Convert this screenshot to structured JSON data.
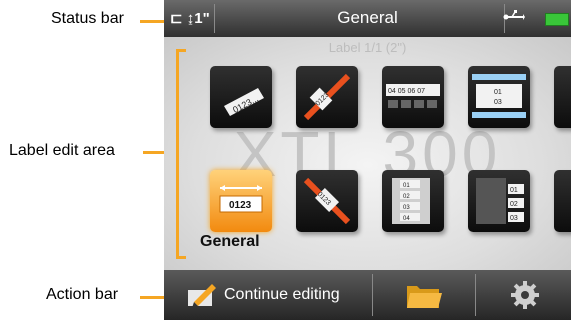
{
  "callouts": {
    "status_bar": "Status bar",
    "label_edit_area": "Label edit area",
    "action_bar": "Action bar"
  },
  "status_bar": {
    "left_indicator": "⊏ ↨1\"",
    "title": "General",
    "usb_icon": "usb-icon",
    "battery_icon": "battery-icon"
  },
  "edit_area": {
    "subtitle": "Label 1/1 (2\")",
    "watermark": "XTL 300",
    "selected_label": "General",
    "tiles": [
      {
        "name": "general-tile",
        "text": "0123..."
      },
      {
        "name": "wire-wrap-tile",
        "text": "0123"
      },
      {
        "name": "patch-panel-tile",
        "text": "04 05 06 07"
      },
      {
        "name": "terminal-block-tile",
        "text": "01 | 03"
      },
      {
        "name": "general-tile-selected",
        "text": "0123"
      },
      {
        "name": "heat-shrink-tile",
        "text": "0123"
      },
      {
        "name": "110-block-tile",
        "text": "01 02 03 04"
      },
      {
        "name": "breaker-tile",
        "text": "01 02 03"
      }
    ]
  },
  "action_bar": {
    "continue_label": "Continue editing",
    "folder_icon": "folder-icon",
    "settings_icon": "gear-icon"
  },
  "colors": {
    "accent": "#f5a623",
    "status_bg": "#404040",
    "battery": "#39c639"
  }
}
